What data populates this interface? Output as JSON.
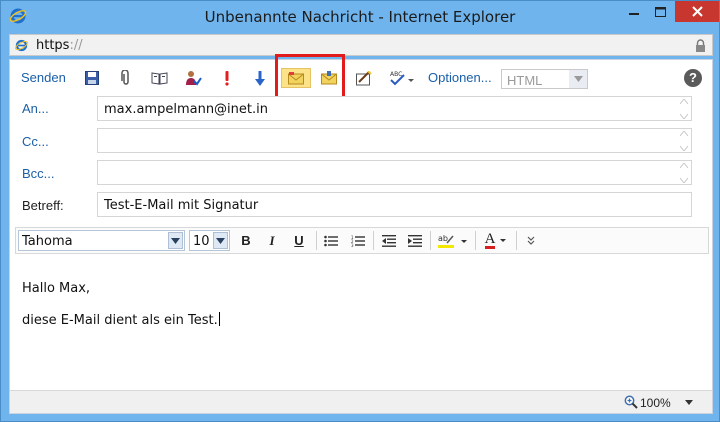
{
  "window": {
    "title": "Unbenannte Nachricht - Internet Explorer",
    "icon": "internet-explorer-icon"
  },
  "address": {
    "protocol": "https",
    "rest": "://"
  },
  "toolbar": {
    "send_label": "Senden",
    "options_label": "Optionen...",
    "format_value": "HTML",
    "help_label": "?",
    "icons": [
      "save-icon",
      "attach-icon",
      "address-book-icon",
      "check-names-icon",
      "importance-high-icon",
      "importance-low-icon",
      "signature-icon",
      "permissions-icon",
      "insert-image-icon",
      "spell-check-icon"
    ]
  },
  "fields": {
    "to_label": "An...",
    "to_value": "max.ampelmann@inet.in",
    "cc_label": "Cc...",
    "cc_value": "",
    "bcc_label": "Bcc...",
    "bcc_value": "",
    "subject_label": "Betreff:",
    "subject_value": "Test-E-Mail mit Signatur"
  },
  "formatting": {
    "font": "Tahoma",
    "size": "10",
    "bold": "B",
    "italic": "I",
    "underline": "U",
    "font_color_label": "A"
  },
  "body": {
    "line1": "Hallo Max,",
    "line2": "diese E-Mail dient als ein Test."
  },
  "status": {
    "zoom": "100%"
  },
  "colors": {
    "accent": "#1a5fa8",
    "highlight_box": "#e21b1b",
    "close_button": "#c7372f"
  }
}
